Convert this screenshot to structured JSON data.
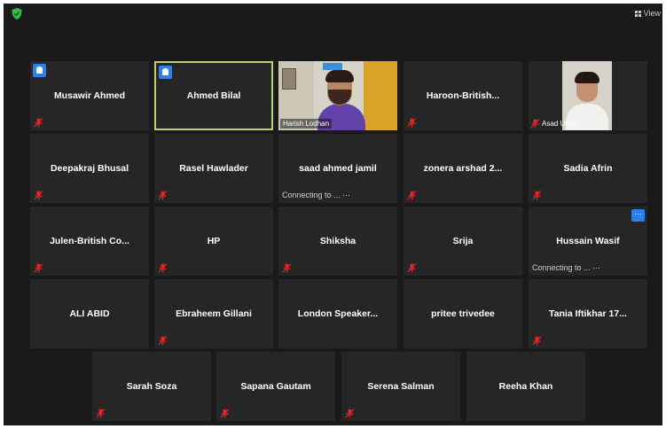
{
  "toolbar": {
    "view_label": "View",
    "view_icon": "grid-view-icon",
    "security_icon": "shield-icon",
    "security_color": "#2fbf4a"
  },
  "participants": [
    {
      "name": "Musawir Ahmed",
      "muted": true,
      "raised_hand": true
    },
    {
      "name": "Ahmed Bilal",
      "muted": false,
      "raised_hand": true,
      "active_speaker": true
    },
    {
      "name": "Harish Lodhan",
      "muted": false,
      "video": true
    },
    {
      "name": "Haroon-British...",
      "muted": true
    },
    {
      "name": "Asad Ullah",
      "muted": true,
      "video": true
    },
    {
      "name": "Deepakraj Bhusal",
      "muted": true
    },
    {
      "name": "Rasel Hawlader",
      "muted": true
    },
    {
      "name": "saad ahmed jamil",
      "muted": false,
      "status": "Connecting to ... ⋯"
    },
    {
      "name": "zonera arshad 2...",
      "muted": true
    },
    {
      "name": "Sadia Afrin",
      "muted": true
    },
    {
      "name": "Julen-British Co...",
      "muted": true
    },
    {
      "name": "HP",
      "muted": true
    },
    {
      "name": "Shiksha",
      "muted": true
    },
    {
      "name": "Srija",
      "muted": true
    },
    {
      "name": "Hussain Wasif",
      "muted": false,
      "status": "Connecting to ... ⋯",
      "more_button": true
    },
    {
      "name": "ALI ABID",
      "muted": false
    },
    {
      "name": "Ebraheem Gillani",
      "muted": true
    },
    {
      "name": "London Speaker...",
      "muted": false
    },
    {
      "name": "pritee trivedee",
      "muted": false
    },
    {
      "name": "Tania Iftikhar 17...",
      "muted": true
    },
    {
      "name": "Sarah Soza",
      "muted": true
    },
    {
      "name": "Sapana Gautam",
      "muted": true
    },
    {
      "name": "Serena Salman",
      "muted": true
    },
    {
      "name": "Reeha Khan",
      "muted": false
    }
  ],
  "icons": {
    "muted_mic": "muted-mic-icon",
    "raised_hand": "raised-hand-icon",
    "more": "more-options-icon",
    "muted_color": "#e02828",
    "accent": "#2d7fea",
    "active_border": "#b7d36b"
  }
}
